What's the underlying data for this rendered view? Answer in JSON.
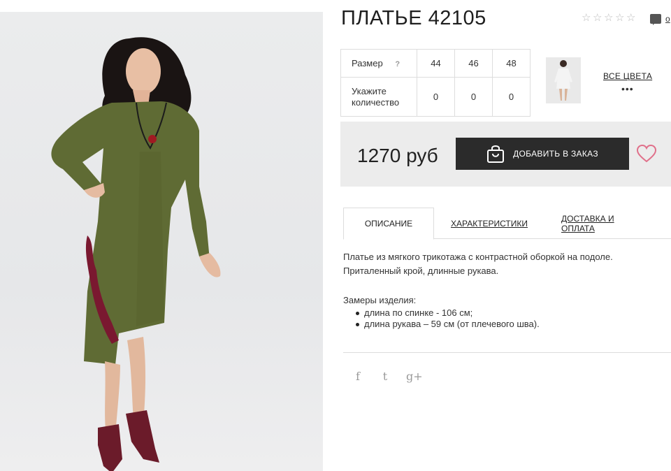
{
  "product": {
    "title": "ПЛАТЬЕ 42105",
    "rating": 0,
    "rating_max": 5,
    "reviews_link": "о"
  },
  "sizes": {
    "size_label": "Размер",
    "help": "?",
    "values": [
      "44",
      "46",
      "48"
    ],
    "qty_label": "Укажите количество",
    "quantities": [
      "0",
      "0",
      "0"
    ]
  },
  "colors": {
    "all_colors": "ВСЕ ЦВЕТА",
    "more": "•••"
  },
  "purchase": {
    "price": "1270 руб",
    "add_button": "ДОБАВИТЬ В ЗАКАЗ",
    "wishlist_icon": "heart-icon",
    "cart_icon": "shopping-bag-icon"
  },
  "tabs": [
    {
      "label": "ОПИСАНИЕ",
      "active": true
    },
    {
      "label": "ХАРАКТЕРИСТИКИ",
      "active": false
    },
    {
      "label": "ДОСТАВКА И ОПЛАТА",
      "active": false
    }
  ],
  "description": {
    "line1": "Платье из мягкого трикотажа с контрастной оборкой на подоле.",
    "line2": "Приталенный крой, длинные рукава.",
    "measures_title": "Замеры изделия:",
    "measures": [
      "длина по спинке - 106 см;",
      "длина рукава – 59 см (от плечевого шва)."
    ]
  },
  "social": {
    "facebook": "f",
    "twitter": "t",
    "googleplus": "g+"
  },
  "colors_palette": {
    "accent_dark": "#2b2b2b",
    "price_bar_bg": "#ececec",
    "heart": "#e0708a",
    "dress": "#5f6b34",
    "ruffle": "#7a1830"
  }
}
